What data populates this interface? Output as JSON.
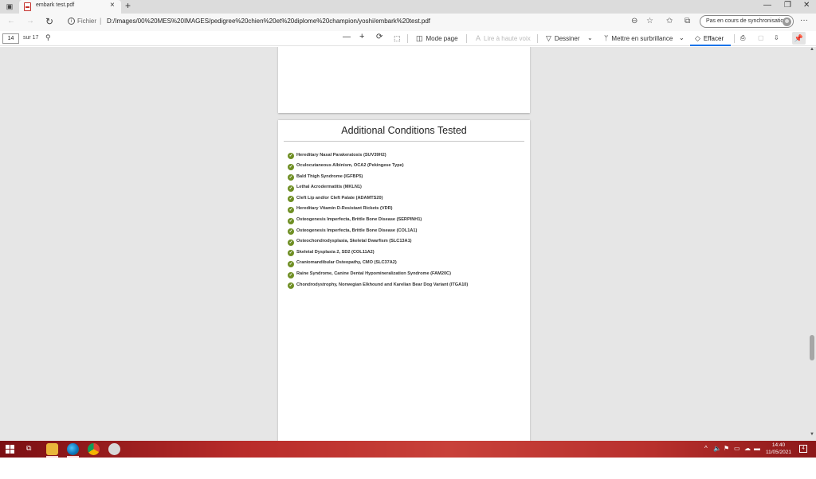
{
  "browser": {
    "tab_title": "embark test.pdf",
    "address_scheme": "Fichier",
    "address_url": "D:/Images/00%20MES%20IMAGES/pedigree%20chien%20et%20diplome%20champion/yoshi/embark%20test.pdf",
    "sync_status": "Pas en cours de synchronisation",
    "icons": {
      "tab_actions": "tab-actions-icon",
      "pdf": "pdf-file-icon",
      "close": "close-icon",
      "new_tab": "plus-icon",
      "back": "back-arrow-icon",
      "forward": "forward-arrow-icon",
      "refresh": "refresh-icon",
      "info": "info-icon",
      "zoom": "zoom-icon",
      "favorite_add": "star-add-icon",
      "favorites": "favorites-icon",
      "collections": "collections-icon",
      "more": "more-icon"
    }
  },
  "pdf_toolbar": {
    "page_number": "14",
    "page_total": "sur 17",
    "mode_page": "Mode page",
    "read_aloud": "Lire à haute voix",
    "draw": "Dessiner",
    "highlight": "Mettre en surbrillance",
    "erase": "Effacer"
  },
  "document": {
    "heading": "Additional Conditions Tested",
    "conditions": [
      "Hereditary Nasal Parakeratosis (SUV39H2)",
      "Oculocutaneous Albinism, OCA2 (Pekingese Type)",
      "Bald Thigh Syndrome (IGFBP5)",
      "Lethal Acrodermatitis (MKLN1)",
      "Cleft Lip and/or Cleft Palate (ADAMTS20)",
      "Hereditary Vitamin D-Resistant Rickets (VDR)",
      "Osteogenesis Imperfecta, Brittle Bone Disease (SERPINH1)",
      "Osteogenesis Imperfecta, Brittle Bone Disease (COL1A1)",
      "Osteochondrodysplasia, Skeletal Dwarfism (SLC13A1)",
      "Skeletal Dysplasia 2, SD2 (COL11A2)",
      "Craniomandibular Osteopathy, CMO (SLC37A2)",
      "Raine Syndrome, Canine Dental Hypomineralization Syndrome (FAM20C)",
      "Chondrodystrophy, Norwegian Elkhound and Karelian Bear Dog Variant (ITGA10)"
    ]
  },
  "taskbar": {
    "time": "14:40",
    "date": "11/05/2021",
    "notification_count": "4"
  },
  "colors": {
    "check_green": "#6f8f24",
    "taskbar_red": "#b92c2a",
    "viewer_gray": "#e6e6e6"
  }
}
